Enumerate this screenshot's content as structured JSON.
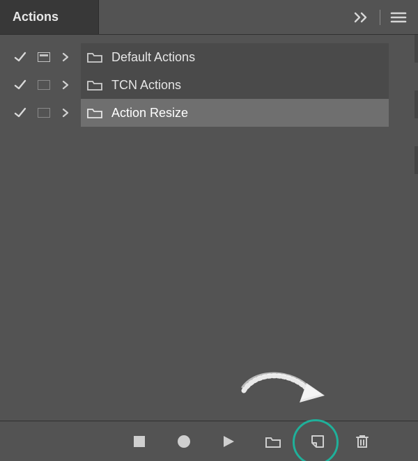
{
  "panel": {
    "title": "Actions"
  },
  "action_sets": [
    {
      "label": "Default Actions",
      "check": true,
      "dialog": "filled",
      "selected": false
    },
    {
      "label": "TCN Actions",
      "check": true,
      "dialog": "empty",
      "selected": false
    },
    {
      "label": "Action Resize",
      "check": true,
      "dialog": "empty",
      "selected": true
    }
  ],
  "icons": {
    "collapse": "double-chevron-right-icon",
    "menu": "hamburger-menu-icon",
    "stop": "stop-icon",
    "record": "record-icon",
    "play": "play-icon",
    "new_set": "folder-icon",
    "new_action": "new-action-icon",
    "trash": "trash-icon"
  }
}
